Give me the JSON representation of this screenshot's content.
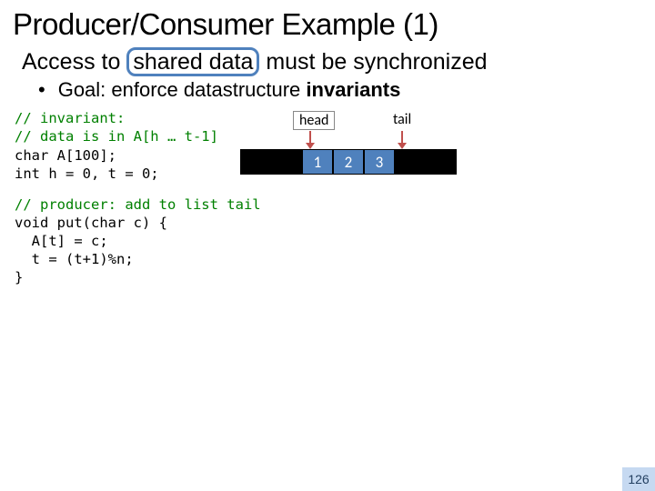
{
  "title": "Producer/Consumer Example (1)",
  "subtitle_pre": "Access to ",
  "subtitle_highlight": "shared data",
  "subtitle_post": " must be synchronized",
  "bullet_dot": "•",
  "bullet_pre": "Goal: enforce datastructure ",
  "bullet_strong": "invariants",
  "code_left": {
    "comment1": "// invariant:",
    "comment2": "// data is in A[h … t-1]",
    "line1": "char A[100];",
    "line2": "int h = 0, t = 0;"
  },
  "diagram": {
    "head_label": "head",
    "tail_label": "tail",
    "cells": [
      {
        "text": "",
        "cls": "black"
      },
      {
        "text": "",
        "cls": "black"
      },
      {
        "text": "1",
        "cls": "filled"
      },
      {
        "text": "2",
        "cls": "filled"
      },
      {
        "text": "3",
        "cls": "filled"
      },
      {
        "text": "",
        "cls": "black"
      },
      {
        "text": "",
        "cls": "black"
      }
    ]
  },
  "code_bottom": {
    "comment": "// producer: add to list tail",
    "l1": "void put(char c) {",
    "l2": "  A[t] = c;",
    "l3": "  t = (t+1)%n;",
    "l4": "}"
  },
  "page_number": "126"
}
